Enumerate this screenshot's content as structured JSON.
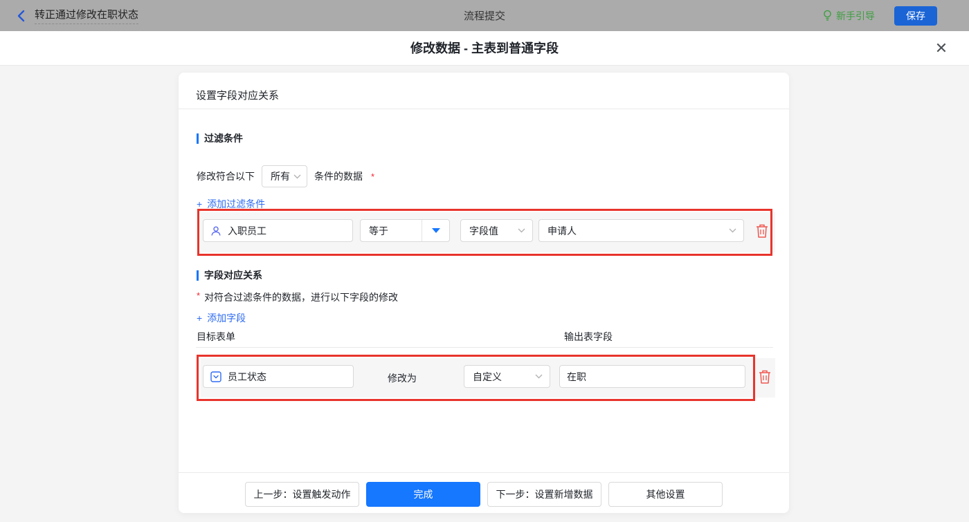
{
  "topbar": {
    "back_title": "转正通过修改在职状态",
    "center_title": "流程提交",
    "guide_label": "新手引导",
    "save_label": "保存"
  },
  "modal": {
    "title": "修改数据 - 主表到普通字段",
    "close_glyph": "✕"
  },
  "panel": {
    "header": "设置字段对应关系",
    "filter_section": {
      "title": "过滤条件",
      "match_prefix": "修改符合以下",
      "match_select_value": "所有",
      "match_suffix": "条件的数据",
      "required_mark": "*",
      "add_plus": "+",
      "add_label": "添加过滤条件",
      "row": {
        "field": "入职员工",
        "operator": "等于",
        "value_type": "字段值",
        "value": "申请人"
      }
    },
    "mapping_section": {
      "title": "字段对应关系",
      "required_mark": "*",
      "description": "对符合过滤条件的数据，进行以下字段的修改",
      "add_plus": "+",
      "add_label": "添加字段",
      "col_target": "目标表单",
      "col_output": "输出表字段",
      "row": {
        "field": "员工状态",
        "action_label": "修改为",
        "mode": "自定义",
        "value": "在职"
      }
    },
    "footer": {
      "prev_label": "上一步：设置触发动作",
      "done_label": "完成",
      "next_label": "下一步：设置新增数据",
      "other_label": "其他设置"
    }
  },
  "colors": {
    "accent_blue": "#1677ff",
    "link_blue": "#2e6bf2",
    "save_blue": "#1a64d6",
    "guide_green": "#3f9e42",
    "highlight_red": "#e8342c",
    "trash_red": "#f0564e",
    "required_red": "#f5222d",
    "topbar_dim_gray": "#ababab",
    "row_gray": "#f6f6f7"
  }
}
